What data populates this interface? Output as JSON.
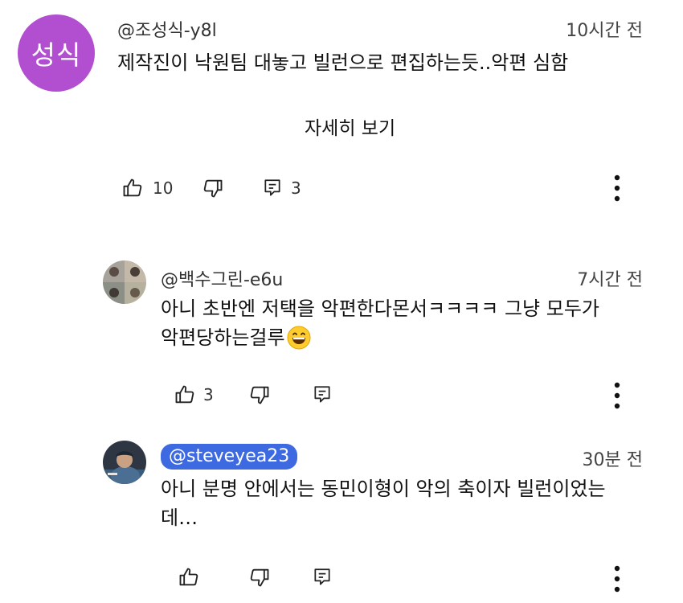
{
  "comments": [
    {
      "avatar_text": "성식",
      "handle": "@조성식-y8l",
      "time": "10시간 전",
      "text": "제작진이 낙원팀 대놓고 빌런으로 편집하는듯..악편 심함",
      "read_more": "자세히 보기",
      "likes": "10",
      "replies": "3",
      "avatar_color": "#b24fd0"
    },
    {
      "handle": "@백수그린-e6u",
      "time": "7시간 전",
      "text_line1": "아니 초반엔 저택을 악편한다몬서ㅋㅋㅋㅋ 그냥 모두가",
      "text_line2": "악편당하는걸루",
      "emoji": "😄",
      "likes": "3"
    },
    {
      "handle": "@steveyea23",
      "time": "30분 전",
      "text_line1": "아니 분명 안에서는 동민이형이 악의 축이자 빌런이었는",
      "text_line2": "데…",
      "handle_color": "#3e6ae1"
    }
  ],
  "icons": [
    "thumb-up-icon",
    "thumb-down-icon",
    "reply-icon",
    "more-vert-icon"
  ]
}
